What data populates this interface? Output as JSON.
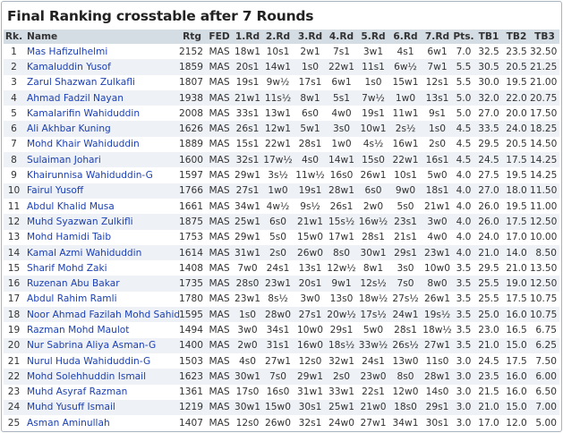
{
  "title": "Final Ranking crosstable after 7 Rounds",
  "columns": [
    "Rk.",
    "Name",
    "Rtg",
    "FED",
    "1.Rd",
    "2.Rd",
    "3.Rd",
    "4.Rd",
    "5.Rd",
    "6.Rd",
    "7.Rd",
    "Pts.",
    "TB1",
    "TB2",
    "TB3"
  ],
  "rows": [
    [
      "1",
      "Mas Hafizulhelmi",
      "2152",
      "MAS",
      "18w1",
      "10s1",
      "2w1",
      "7s1",
      "3w1",
      "4s1",
      "6w1",
      "7.0",
      "32.5",
      "23.5",
      "32.50"
    ],
    [
      "2",
      "Kamaluddin Yusof",
      "1859",
      "MAS",
      "20s1",
      "14w1",
      "1s0",
      "22w1",
      "11s1",
      "6w½",
      "7w1",
      "5.5",
      "30.5",
      "20.5",
      "21.25"
    ],
    [
      "3",
      "Zarul Shazwan Zulkafli",
      "1807",
      "MAS",
      "19s1",
      "9w½",
      "17s1",
      "6w1",
      "1s0",
      "15w1",
      "12s1",
      "5.5",
      "30.0",
      "19.5",
      "21.00"
    ],
    [
      "4",
      "Ahmad Fadzil Nayan",
      "1938",
      "MAS",
      "21w1",
      "11s½",
      "8w1",
      "5s1",
      "7w½",
      "1w0",
      "13s1",
      "5.0",
      "32.0",
      "22.0",
      "20.75"
    ],
    [
      "5",
      "Kamalarifin Wahiduddin",
      "2008",
      "MAS",
      "33s1",
      "13w1",
      "6s0",
      "4w0",
      "19s1",
      "11w1",
      "9s1",
      "5.0",
      "27.0",
      "20.0",
      "17.50"
    ],
    [
      "6",
      "Ali Akhbar Kuning",
      "1626",
      "MAS",
      "26s1",
      "12w1",
      "5w1",
      "3s0",
      "10w1",
      "2s½",
      "1s0",
      "4.5",
      "33.5",
      "24.0",
      "18.25"
    ],
    [
      "7",
      "Mohd Khair Wahiduddin",
      "1889",
      "MAS",
      "15s1",
      "22w1",
      "28s1",
      "1w0",
      "4s½",
      "16w1",
      "2s0",
      "4.5",
      "29.5",
      "20.5",
      "14.50"
    ],
    [
      "8",
      "Sulaiman Johari",
      "1600",
      "MAS",
      "32s1",
      "17w½",
      "4s0",
      "14w1",
      "15s0",
      "22w1",
      "16s1",
      "4.5",
      "24.5",
      "17.5",
      "14.25"
    ],
    [
      "9",
      "Khairunnisa Wahiduddin-G",
      "1597",
      "MAS",
      "29w1",
      "3s½",
      "11w½",
      "16s0",
      "26w1",
      "10s1",
      "5w0",
      "4.0",
      "27.5",
      "19.5",
      "14.25"
    ],
    [
      "10",
      "Fairul Yusoff",
      "1766",
      "MAS",
      "27s1",
      "1w0",
      "19s1",
      "28w1",
      "6s0",
      "9w0",
      "18s1",
      "4.0",
      "27.0",
      "18.0",
      "11.50"
    ],
    [
      "11",
      "Abdul Khalid Musa",
      "1661",
      "MAS",
      "34w1",
      "4w½",
      "9s½",
      "26s1",
      "2w0",
      "5s0",
      "21w1",
      "4.0",
      "26.0",
      "19.5",
      "11.00"
    ],
    [
      "12",
      "Muhd Syazwan Zulkifli",
      "1875",
      "MAS",
      "25w1",
      "6s0",
      "21w1",
      "15s½",
      "16w½",
      "23s1",
      "3w0",
      "4.0",
      "26.0",
      "17.5",
      "12.50"
    ],
    [
      "13",
      "Mohd Hamidi Taib",
      "1753",
      "MAS",
      "29w1",
      "5s0",
      "15w0",
      "17w1",
      "28s1",
      "21s1",
      "4w0",
      "4.0",
      "24.0",
      "17.0",
      "10.00"
    ],
    [
      "14",
      "Kamal Azmi Wahiduddin",
      "1614",
      "MAS",
      "31w1",
      "2s0",
      "26w0",
      "8s0",
      "30w1",
      "29s1",
      "23w1",
      "4.0",
      "21.0",
      "14.0",
      "8.50"
    ],
    [
      "15",
      "Sharif Mohd Zaki",
      "1408",
      "MAS",
      "7w0",
      "24s1",
      "13s1",
      "12w½",
      "8w1",
      "3s0",
      "10w0",
      "3.5",
      "29.5",
      "21.0",
      "13.50"
    ],
    [
      "16",
      "Ruzenan Abu Bakar",
      "1735",
      "MAS",
      "28s0",
      "23w1",
      "20s1",
      "9w1",
      "12s½",
      "7s0",
      "8w0",
      "3.5",
      "25.5",
      "19.0",
      "12.50"
    ],
    [
      "17",
      "Abdul Rahim Ramli",
      "1780",
      "MAS",
      "23w1",
      "8s½",
      "3w0",
      "13s0",
      "18w½",
      "27s½",
      "26w1",
      "3.5",
      "25.5",
      "17.5",
      "10.75"
    ],
    [
      "18",
      "Noor Ahmad Fazilah Mohd Sahid",
      "1595",
      "MAS",
      "1s0",
      "28w0",
      "27s1",
      "20w½",
      "17s½",
      "24w1",
      "19s½",
      "3.5",
      "25.0",
      "16.0",
      "10.75"
    ],
    [
      "19",
      "Razman Mohd Maulot",
      "1494",
      "MAS",
      "3w0",
      "34s1",
      "10w0",
      "29s1",
      "5w0",
      "28s1",
      "18w½",
      "3.5",
      "23.0",
      "16.5",
      "6.75"
    ],
    [
      "20",
      "Nur Sabrina Aliya Asman-G",
      "1400",
      "MAS",
      "2w0",
      "31s1",
      "16w0",
      "18s½",
      "33w½",
      "26s½",
      "27w1",
      "3.5",
      "21.0",
      "15.0",
      "6.25"
    ],
    [
      "21",
      "Nurul Huda Wahiduddin-G",
      "1503",
      "MAS",
      "4s0",
      "27w1",
      "12s0",
      "32w1",
      "24s1",
      "13w0",
      "11s0",
      "3.0",
      "24.5",
      "17.5",
      "7.50"
    ],
    [
      "22",
      "Mohd Solehhuddin Ismail",
      "1623",
      "MAS",
      "30w1",
      "7s0",
      "29w1",
      "2s0",
      "23w0",
      "8s0",
      "28w1",
      "3.0",
      "23.5",
      "16.0",
      "6.00"
    ],
    [
      "23",
      "Muhd Asyraf Razman",
      "1361",
      "MAS",
      "17s0",
      "16s0",
      "31w1",
      "33w1",
      "22s1",
      "12w0",
      "14s0",
      "3.0",
      "21.5",
      "16.0",
      "6.50"
    ],
    [
      "24",
      "Muhd Yusuff Ismail",
      "1219",
      "MAS",
      "30w1",
      "15w0",
      "30s1",
      "25w1",
      "21w0",
      "18s0",
      "29s1",
      "3.0",
      "21.0",
      "15.0",
      "7.00"
    ],
    [
      "25",
      "Asman Aminullah",
      "1407",
      "MAS",
      "12s0",
      "26w0",
      "32s1",
      "24w0",
      "27w1",
      "34w1",
      "30s1",
      "3.0",
      "17.0",
      "12.0",
      "5.00"
    ]
  ]
}
